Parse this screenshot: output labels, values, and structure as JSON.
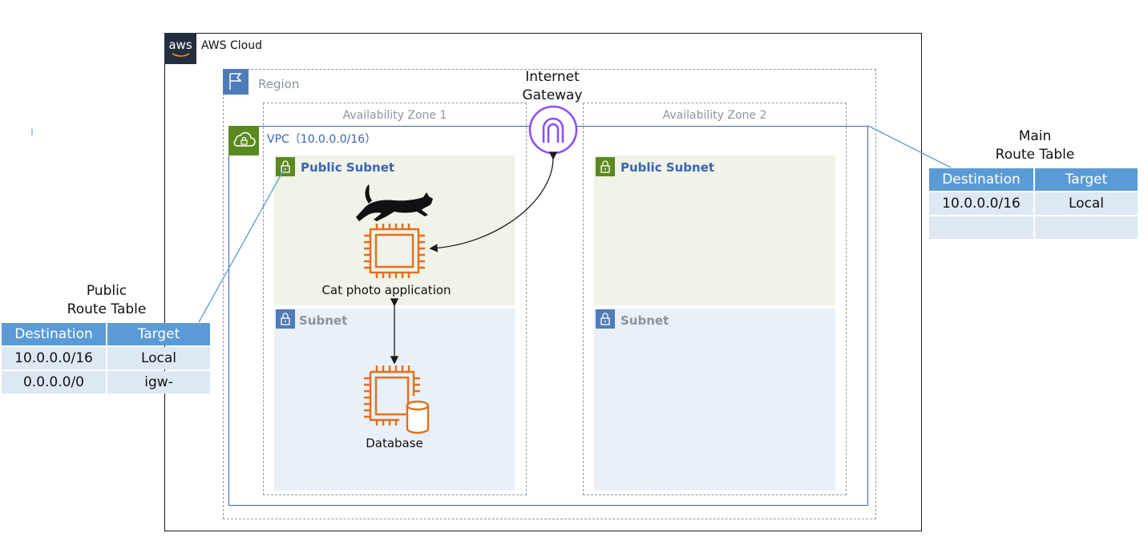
{
  "aws": {
    "logo_text": "aws",
    "label": "AWS Cloud"
  },
  "region": {
    "label": "Region"
  },
  "az1": {
    "label": "Availability Zone 1"
  },
  "az2": {
    "label": "Availability Zone 2"
  },
  "vpc": {
    "label": "VPC（10.0.0.0/16）"
  },
  "subnets": {
    "public1": "Public Subnet",
    "public2": "Public Subnet",
    "private1": "Subnet",
    "private2": "Subnet"
  },
  "app": {
    "label": "Cat photo application"
  },
  "database": {
    "label": "Database"
  },
  "igw": {
    "line1": "Internet",
    "line2": "Gateway"
  },
  "public_rt": {
    "title1": "Public",
    "title2": "Route Table",
    "headers": [
      "Destination",
      "Target"
    ],
    "rows": [
      [
        "10.0.0.0/16",
        "Local"
      ],
      [
        "0.0.0.0/0",
        "igw-"
      ]
    ]
  },
  "main_rt": {
    "title1": "Main",
    "title2": "Route Table",
    "headers": [
      "Destination",
      "Target"
    ],
    "rows": [
      [
        "10.0.0.0/16",
        "Local"
      ],
      [
        "",
        ""
      ]
    ]
  },
  "colors": {
    "vpc_border": "#3a63b4",
    "public_subnet_bg": "#eff3e8",
    "private_subnet_bg": "#e9f0f8",
    "ec2_orange": "#e46e1a",
    "igw_purple": "#8c4fff",
    "table_header": "#5b9bd5",
    "table_cell": "#dde8f3"
  }
}
